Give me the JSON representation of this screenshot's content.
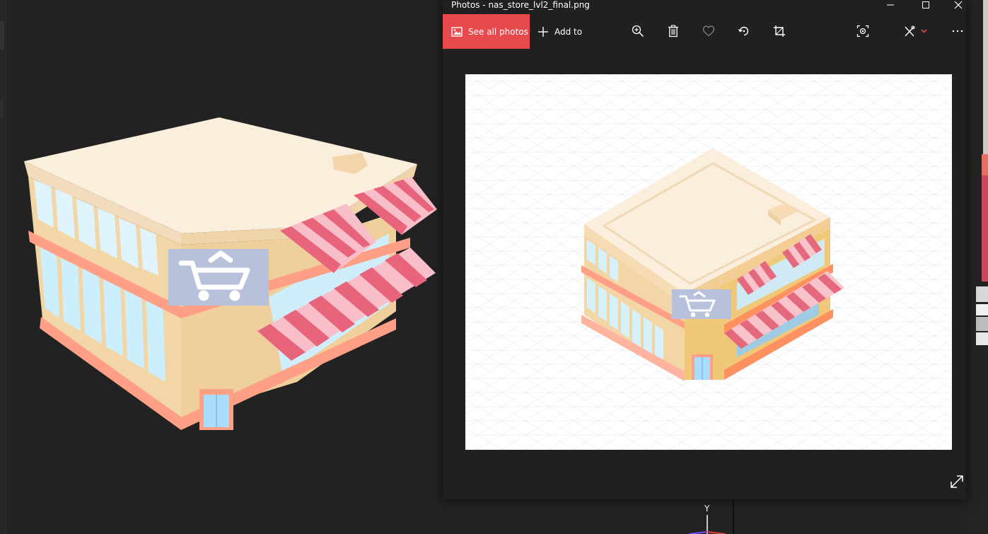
{
  "window": {
    "title": "Photos - nas_store_lvl2_final.png",
    "controls": {
      "minimize": "minimize-icon",
      "maximize": "maximize-icon",
      "close": "close-icon"
    }
  },
  "toolbar": {
    "see_all_label": "See all photos",
    "add_to_label": "Add to",
    "icons": [
      "zoom-in-icon",
      "delete-icon",
      "favorite-icon",
      "rotate-icon",
      "crop-icon",
      "live-icon",
      "edit-icon",
      "more-icon"
    ]
  },
  "viewport": {
    "gizmo_axis_label": "Y"
  },
  "colors": {
    "accent": "#e8494d",
    "app_bg": "#202020",
    "viewport_bg": "#222222",
    "store_wall": "#f3d6a5",
    "store_roof": "#fbeedd",
    "store_trim": "#ff9f85",
    "awning_red": "#e8647a",
    "awning_light": "#f8bfca",
    "glass": "#cfeffd",
    "sign": "#b8c1dc"
  }
}
